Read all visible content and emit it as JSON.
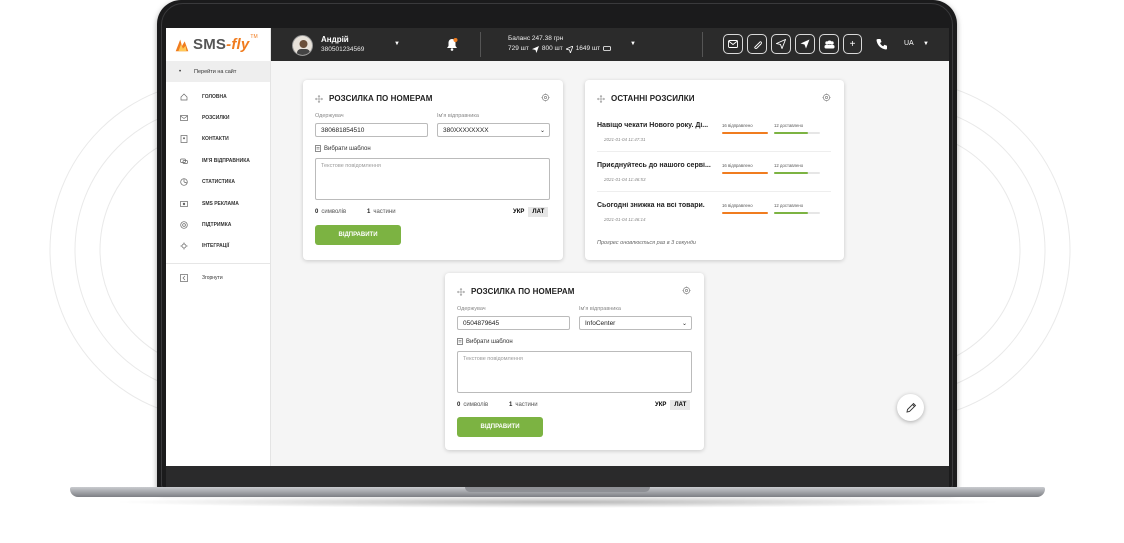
{
  "brand": {
    "name_left": "SMS",
    "name_dash": "-",
    "name_right": "fly",
    "tm": "TM"
  },
  "header": {
    "user_name": "Андрій",
    "user_phone": "380501234569",
    "balance_label": "Баланс 247.38 грн",
    "balance_counts": [
      "729 шт",
      "800 шт",
      "1649 шт"
    ],
    "plus": "+",
    "language": "UA"
  },
  "sidebar": {
    "goto_site": "Перейти на сайт",
    "items": [
      {
        "label": "ГОЛОВНА",
        "icon": "home-icon"
      },
      {
        "label": "РОЗСИЛКИ",
        "icon": "mail-icon"
      },
      {
        "label": "КОНТАКТИ",
        "icon": "contacts-icon"
      },
      {
        "label": "ІМ'Я ВІДПРАВНИКА",
        "icon": "sender-icon"
      },
      {
        "label": "СТАТИСТИКА",
        "icon": "chart-icon"
      },
      {
        "label": "SMS РЕКЛАМА",
        "icon": "ad-icon"
      },
      {
        "label": "ПІДТРИМКА",
        "icon": "support-icon"
      },
      {
        "label": "ІНТЕГРАЦІЇ",
        "icon": "integrations-icon"
      }
    ],
    "collapse": "Згорнути"
  },
  "card1": {
    "title": "РОЗСИЛКА ПО НОМЕРАМ",
    "recipient_label": "Одержувач",
    "recipient_value": "380681854510",
    "sender_label": "Ім'я відправника",
    "sender_value": "380XXXXXXXX",
    "template_link": "Вибрати шаблон",
    "message_placeholder": "Текстове повідомлення",
    "symbols_count": "0",
    "symbols_label": "символів",
    "parts_count": "1",
    "parts_label": "частини",
    "lang_ukr": "УКР",
    "lang_lat": "ЛАТ",
    "send": "ВІДПРАВИТИ"
  },
  "recent": {
    "title": "ОСТАННІ РОЗСИЛКИ",
    "items": [
      {
        "name": "Навіщо чекати Нового року. Ді...",
        "date": "2021-01-04 11:47:31",
        "sent": "16 відправлено",
        "delivered": "12 доставлено"
      },
      {
        "name": "Приєднуйтесь до нашого серві...",
        "date": "2021-01-04 11:46:53",
        "sent": "16 відправлено",
        "delivered": "12 доставлено"
      },
      {
        "name": "Сьогодні знижка на всі товари.",
        "date": "2021-01-04 11:46:14",
        "sent": "16 відправлено",
        "delivered": "12 доставлено"
      }
    ],
    "progress_note": "Прогрес оновлюється раз в 3 секунди"
  },
  "card2": {
    "title": "РОЗСИЛКА ПО НОМЕРАМ",
    "recipient_label": "Одержувач",
    "recipient_value": "0504879645",
    "sender_label": "Ім'я відправника",
    "sender_value": "InfoCenter",
    "template_link": "Вибрати шаблон",
    "message_placeholder": "Текстове повідомлення",
    "symbols_count": "0",
    "symbols_label": "символів",
    "parts_count": "1",
    "parts_label": "частини",
    "lang_ukr": "УКР",
    "lang_lat": "ЛАТ",
    "send": "ВІДПРАВИТИ"
  },
  "colors": {
    "accent_green": "#7cb342",
    "accent_orange": "#f07c1f",
    "header_bg": "#2b2b2b"
  }
}
